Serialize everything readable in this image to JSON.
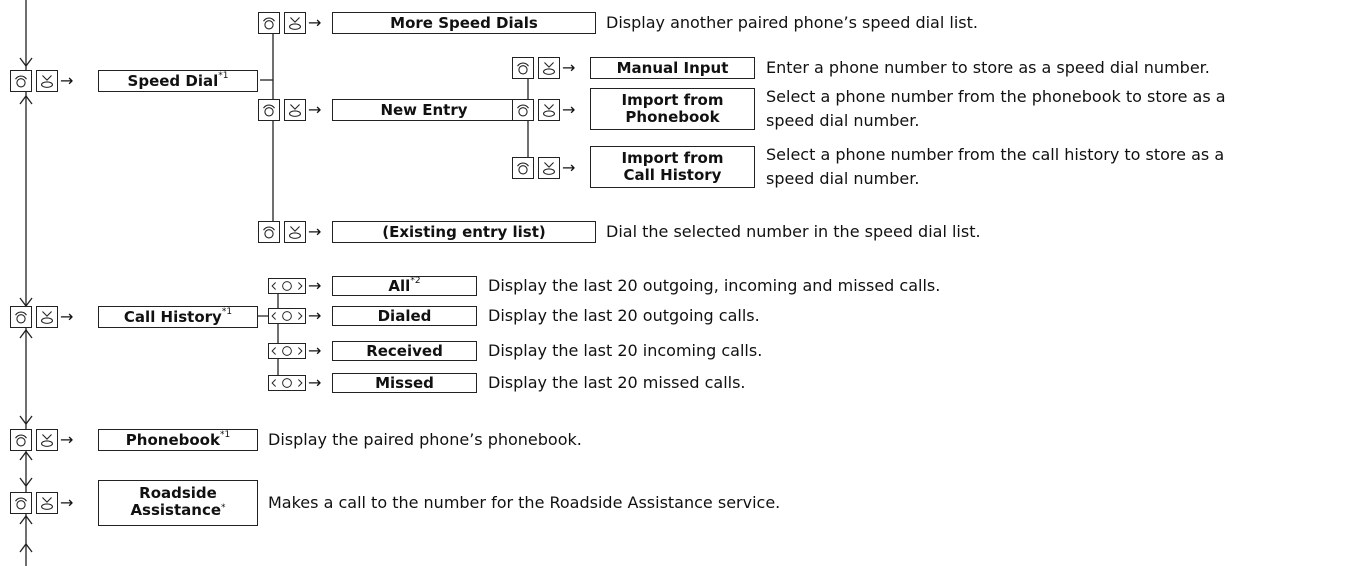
{
  "items": {
    "speed_dial": {
      "label": "Speed Dial",
      "sup": "*1"
    },
    "more_speed_dials": {
      "label": "More Speed Dials",
      "desc": "Display another paired phone’s speed dial list."
    },
    "new_entry": {
      "label": "New Entry"
    },
    "manual_input": {
      "label": "Manual Input",
      "desc": "Enter a phone number to store as a speed dial number."
    },
    "import_phonebook": {
      "label1": "Import from",
      "label2": "Phonebook",
      "desc1": "Select a phone number from the phonebook to store as a",
      "desc2": "speed dial number."
    },
    "import_call_history": {
      "label1": "Import from",
      "label2": "Call History",
      "desc1": "Select a phone number from the call history to store as a",
      "desc2": "speed dial number."
    },
    "existing_entry": {
      "label": "(Existing entry list)",
      "desc": "Dial the selected number in the speed dial list."
    },
    "call_history": {
      "label": "Call History",
      "sup": "*1"
    },
    "all": {
      "label": "All",
      "sup": "*2",
      "desc": "Display the last 20 outgoing, incoming and missed calls."
    },
    "dialed": {
      "label": "Dialed",
      "desc": "Display the last 20 outgoing calls."
    },
    "received": {
      "label": "Received",
      "desc": "Display the last 20 incoming calls."
    },
    "missed": {
      "label": "Missed",
      "desc": "Display the last 20 missed calls."
    },
    "phonebook": {
      "label": "Phonebook",
      "sup": "*1",
      "desc": "Display the paired phone’s phonebook."
    },
    "roadside": {
      "label1": "Roadside",
      "label2": "Assistance",
      "sup": "*",
      "desc": "Makes a call to the number for the Roadside Assistance service."
    }
  },
  "icons": {
    "rotate": "interface-dial-rotate-icon",
    "press": "interface-dial-press-icon",
    "slide": "interface-dial-slide-icon"
  }
}
